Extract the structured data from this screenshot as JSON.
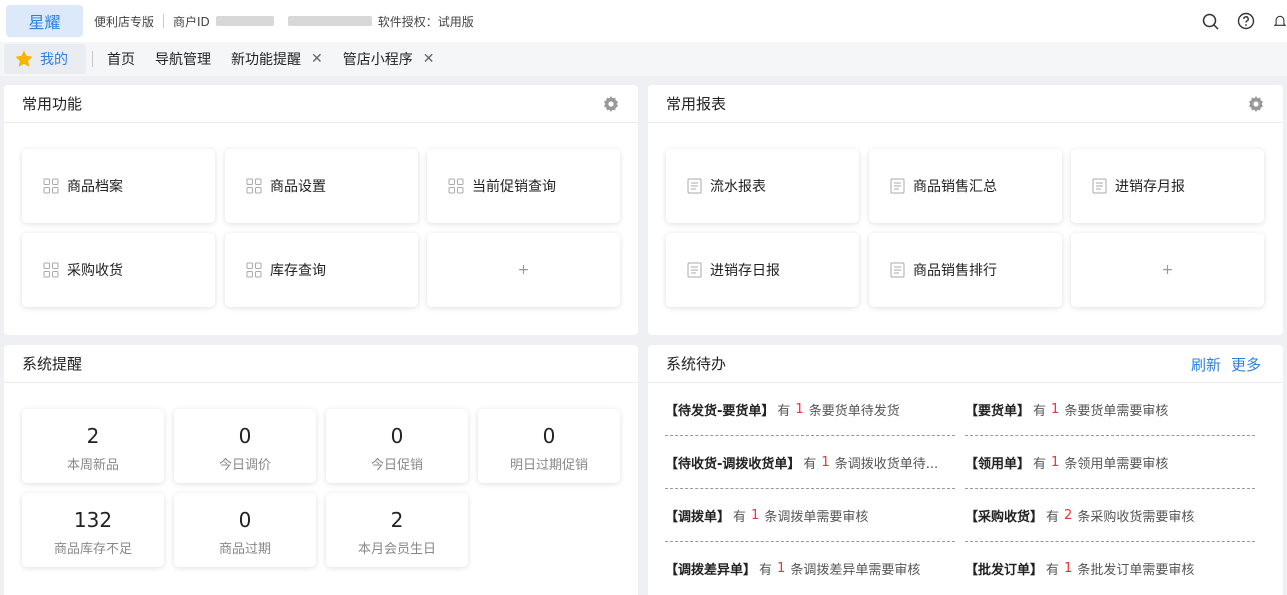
{
  "topbar": {
    "brand": "星耀",
    "store_type": "便利店专版",
    "merchant_label": "商户ID",
    "license": "软件授权：试用版"
  },
  "tabs": {
    "mine": "我的",
    "items": [
      {
        "label": "首页",
        "closable": false
      },
      {
        "label": "导航管理",
        "closable": false
      },
      {
        "label": "新功能提醒",
        "closable": true
      },
      {
        "label": "管店小程序",
        "closable": true
      }
    ],
    "close_glyph": "✕"
  },
  "common_functions": {
    "title": "常用功能",
    "items": [
      "商品档案",
      "商品设置",
      "当前促销查询",
      "采购收货",
      "库存查询"
    ],
    "add": "+"
  },
  "common_reports": {
    "title": "常用报表",
    "items": [
      "流水报表",
      "商品销售汇总",
      "进销存月报",
      "进销存日报",
      "商品销售排行"
    ],
    "add": "+"
  },
  "system_reminder": {
    "title": "系统提醒",
    "stats": [
      {
        "value": "2",
        "label": "本周新品"
      },
      {
        "value": "0",
        "label": "今日调价"
      },
      {
        "value": "0",
        "label": "今日促销"
      },
      {
        "value": "0",
        "label": "明日过期促销"
      },
      {
        "value": "132",
        "label": "商品库存不足"
      },
      {
        "value": "0",
        "label": "商品过期"
      },
      {
        "value": "2",
        "label": "本月会员生日"
      }
    ]
  },
  "system_todo": {
    "title": "系统待办",
    "refresh": "刷新",
    "more": "更多",
    "items": [
      {
        "tag": "【待发货-要货单】",
        "pre": "有",
        "count": "1",
        "post": "条要货单待发货"
      },
      {
        "tag": "【要货单】",
        "pre": "有",
        "count": "1",
        "post": "条要货单需要审核"
      },
      {
        "tag": "【待收货-调拨收货单】",
        "pre": "有",
        "count": "1",
        "post": "条调拨收货单待..."
      },
      {
        "tag": "【领用单】",
        "pre": "有",
        "count": "1",
        "post": "条领用单需要审核"
      },
      {
        "tag": "【调拨单】",
        "pre": "有",
        "count": "1",
        "post": "条调拨单需要审核"
      },
      {
        "tag": "【采购收货】",
        "pre": "有",
        "count": "2",
        "post": "条采购收货需要审核"
      },
      {
        "tag": "【调拨差异单】",
        "pre": "有",
        "count": "1",
        "post": "条调拨差异单需要审核"
      },
      {
        "tag": "【批发订单】",
        "pre": "有",
        "count": "1",
        "post": "条批发订单需要审核"
      }
    ]
  },
  "colors": {
    "accent": "#2f7fe0",
    "count_red": "#e33",
    "star": "#f5b400"
  }
}
